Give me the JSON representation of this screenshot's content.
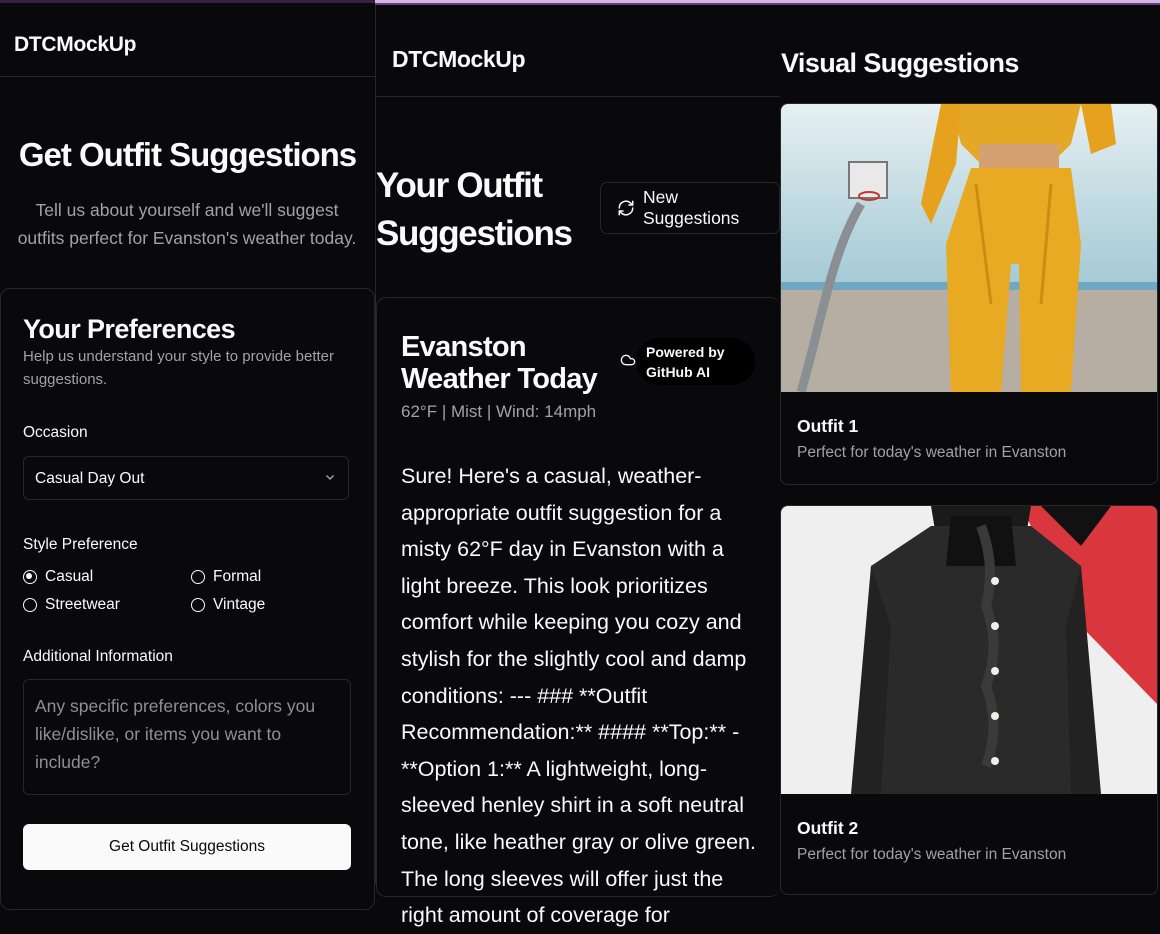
{
  "left": {
    "brand": "DTCMockUp",
    "hero_title": "Get Outfit Suggestions",
    "hero_subtitle": "Tell us about yourself and we'll suggest outfits perfect for Evanston's weather today.",
    "prefs": {
      "title": "Your Preferences",
      "subtitle": "Help us understand your style to provide better suggestions.",
      "occasion_label": "Occasion",
      "occasion_value": "Casual Day Out",
      "style_label": "Style Preference",
      "styles": [
        "Casual",
        "Formal",
        "Streetwear",
        "Vintage"
      ],
      "selected_style": "Casual",
      "additional_label": "Additional Information",
      "additional_placeholder": "Any specific preferences, colors you like/dislike, or items you want to include?",
      "submit_label": "Get Outfit Suggestions"
    }
  },
  "middle": {
    "brand": "DTCMockUp",
    "title": "Your Outfit Suggestions",
    "new_button": "New Suggestions",
    "weather": {
      "title": "Evanston Weather Today",
      "powered_by": "Powered by GitHub AI",
      "meta": "62°F | Mist | Wind: 14mph",
      "body": "Sure! Here's a casual, weather-appropriate outfit suggestion for a misty 62°F day in Evanston with a light breeze. This look prioritizes comfort while keeping you cozy and stylish for the slightly cool and damp conditions: --- ### **Outfit Recommendation:** #### **Top:** - **Option 1:** A lightweight, long-sleeved henley shirt in a soft neutral tone, like heather gray or olive green. The long sleeves will offer just the right amount of coverage for"
    }
  },
  "right": {
    "title": "Visual Suggestions",
    "outfits": [
      {
        "name": "Outfit 1",
        "desc": "Perfect for today's weather in Evanston"
      },
      {
        "name": "Outfit 2",
        "desc": "Perfect for today's weather in Evanston"
      }
    ]
  }
}
